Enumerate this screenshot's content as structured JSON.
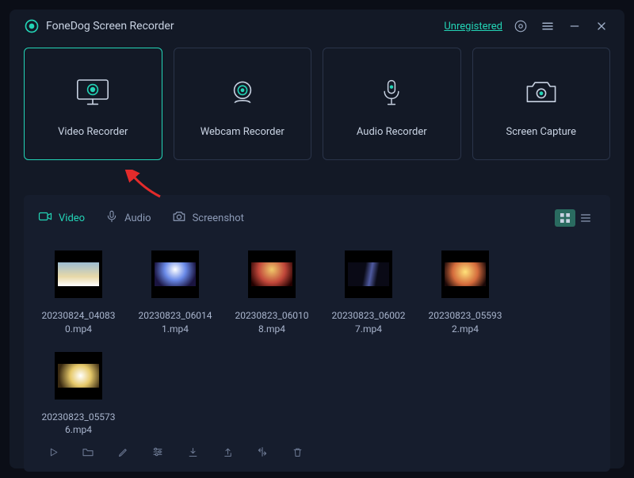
{
  "header": {
    "app_title": "FoneDog Screen Recorder",
    "register_label": "Unregistered"
  },
  "modes": [
    {
      "label": "Video Recorder",
      "active": true
    },
    {
      "label": "Webcam Recorder",
      "active": false
    },
    {
      "label": "Audio Recorder",
      "active": false
    },
    {
      "label": "Screen Capture",
      "active": false
    }
  ],
  "library": {
    "tabs": {
      "video": "Video",
      "audio": "Audio",
      "screenshot": "Screenshot"
    },
    "items": [
      {
        "name": "20230824_040830.mp4"
      },
      {
        "name": "20230823_060141.mp4"
      },
      {
        "name": "20230823_060108.mp4"
      },
      {
        "name": "20230823_060027.mp4"
      },
      {
        "name": "20230823_055932.mp4"
      },
      {
        "name": "20230823_055736.mp4"
      }
    ]
  },
  "colors": {
    "accent": "#23d4b6",
    "bg": "#131926",
    "panel": "#161d2d"
  }
}
